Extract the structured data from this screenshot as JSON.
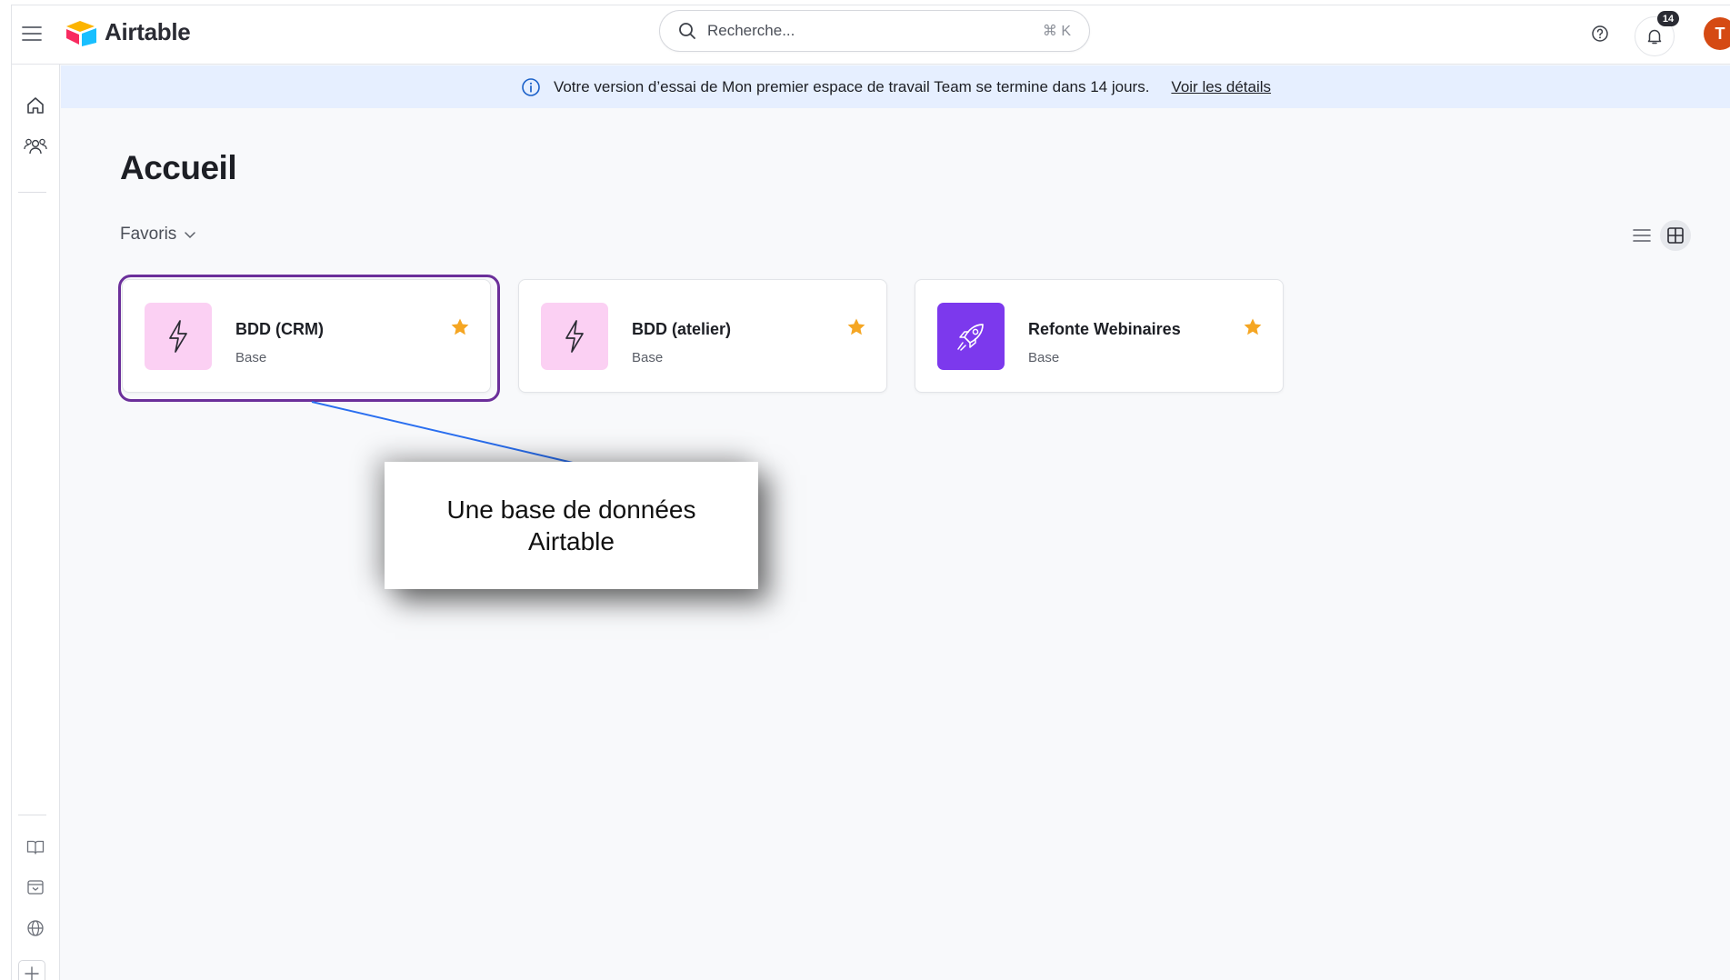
{
  "app": {
    "name": "Airtable"
  },
  "search": {
    "label": "Recherche...",
    "shortcut": "⌘ K"
  },
  "notifications": {
    "count": "14"
  },
  "user": {
    "initial": "T",
    "color": "#d54a13"
  },
  "banner": {
    "message": "Votre version d’essai de Mon premier espace de travail Team se termine dans 14 jours.",
    "link": "Voir les détails"
  },
  "page": {
    "title": "Accueil"
  },
  "section": {
    "label": "Favoris"
  },
  "bases": [
    {
      "name": "BDD (CRM)",
      "type": "Base",
      "icon": "bolt-icon",
      "icon_bg": "#fbd0f3",
      "starred": true
    },
    {
      "name": "BDD (atelier)",
      "type": "Base",
      "icon": "bolt-icon",
      "icon_bg": "#fbd0f3",
      "starred": true
    },
    {
      "name": "Refonte Webinaires",
      "type": "Base",
      "icon": "rocket-icon",
      "icon_bg": "#7c39ed",
      "starred": true
    }
  ],
  "callout": {
    "text": "Une base de données\nAirtable"
  },
  "colors": {
    "accent_star": "#f5a623",
    "highlight": "#6b2f9a",
    "callout_line": "#2a6ff0",
    "banner_bg": "#e6efff"
  }
}
